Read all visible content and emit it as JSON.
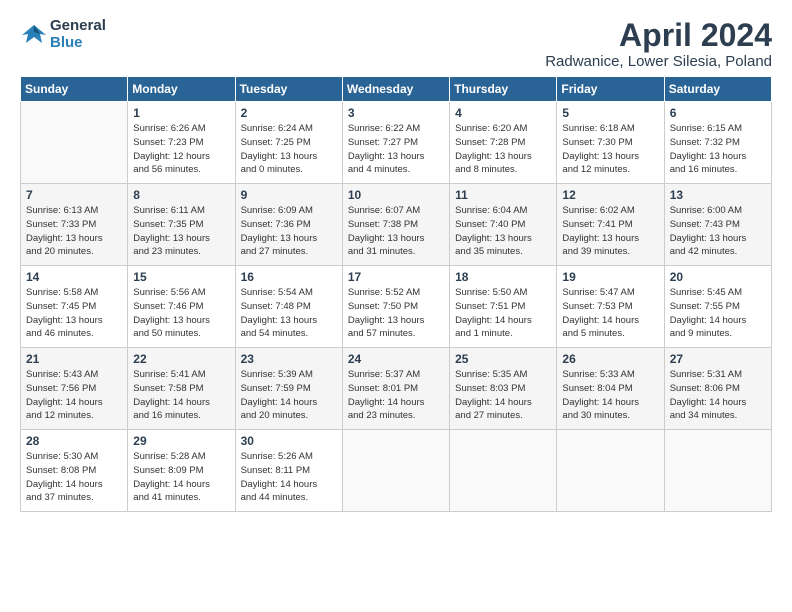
{
  "logo": {
    "general": "General",
    "blue": "Blue"
  },
  "title": "April 2024",
  "subtitle": "Radwanice, Lower Silesia, Poland",
  "days_of_week": [
    "Sunday",
    "Monday",
    "Tuesday",
    "Wednesday",
    "Thursday",
    "Friday",
    "Saturday"
  ],
  "weeks": [
    [
      {
        "num": "",
        "info": ""
      },
      {
        "num": "1",
        "info": "Sunrise: 6:26 AM\nSunset: 7:23 PM\nDaylight: 12 hours\nand 56 minutes."
      },
      {
        "num": "2",
        "info": "Sunrise: 6:24 AM\nSunset: 7:25 PM\nDaylight: 13 hours\nand 0 minutes."
      },
      {
        "num": "3",
        "info": "Sunrise: 6:22 AM\nSunset: 7:27 PM\nDaylight: 13 hours\nand 4 minutes."
      },
      {
        "num": "4",
        "info": "Sunrise: 6:20 AM\nSunset: 7:28 PM\nDaylight: 13 hours\nand 8 minutes."
      },
      {
        "num": "5",
        "info": "Sunrise: 6:18 AM\nSunset: 7:30 PM\nDaylight: 13 hours\nand 12 minutes."
      },
      {
        "num": "6",
        "info": "Sunrise: 6:15 AM\nSunset: 7:32 PM\nDaylight: 13 hours\nand 16 minutes."
      }
    ],
    [
      {
        "num": "7",
        "info": "Sunrise: 6:13 AM\nSunset: 7:33 PM\nDaylight: 13 hours\nand 20 minutes."
      },
      {
        "num": "8",
        "info": "Sunrise: 6:11 AM\nSunset: 7:35 PM\nDaylight: 13 hours\nand 23 minutes."
      },
      {
        "num": "9",
        "info": "Sunrise: 6:09 AM\nSunset: 7:36 PM\nDaylight: 13 hours\nand 27 minutes."
      },
      {
        "num": "10",
        "info": "Sunrise: 6:07 AM\nSunset: 7:38 PM\nDaylight: 13 hours\nand 31 minutes."
      },
      {
        "num": "11",
        "info": "Sunrise: 6:04 AM\nSunset: 7:40 PM\nDaylight: 13 hours\nand 35 minutes."
      },
      {
        "num": "12",
        "info": "Sunrise: 6:02 AM\nSunset: 7:41 PM\nDaylight: 13 hours\nand 39 minutes."
      },
      {
        "num": "13",
        "info": "Sunrise: 6:00 AM\nSunset: 7:43 PM\nDaylight: 13 hours\nand 42 minutes."
      }
    ],
    [
      {
        "num": "14",
        "info": "Sunrise: 5:58 AM\nSunset: 7:45 PM\nDaylight: 13 hours\nand 46 minutes."
      },
      {
        "num": "15",
        "info": "Sunrise: 5:56 AM\nSunset: 7:46 PM\nDaylight: 13 hours\nand 50 minutes."
      },
      {
        "num": "16",
        "info": "Sunrise: 5:54 AM\nSunset: 7:48 PM\nDaylight: 13 hours\nand 54 minutes."
      },
      {
        "num": "17",
        "info": "Sunrise: 5:52 AM\nSunset: 7:50 PM\nDaylight: 13 hours\nand 57 minutes."
      },
      {
        "num": "18",
        "info": "Sunrise: 5:50 AM\nSunset: 7:51 PM\nDaylight: 14 hours\nand 1 minute."
      },
      {
        "num": "19",
        "info": "Sunrise: 5:47 AM\nSunset: 7:53 PM\nDaylight: 14 hours\nand 5 minutes."
      },
      {
        "num": "20",
        "info": "Sunrise: 5:45 AM\nSunset: 7:55 PM\nDaylight: 14 hours\nand 9 minutes."
      }
    ],
    [
      {
        "num": "21",
        "info": "Sunrise: 5:43 AM\nSunset: 7:56 PM\nDaylight: 14 hours\nand 12 minutes."
      },
      {
        "num": "22",
        "info": "Sunrise: 5:41 AM\nSunset: 7:58 PM\nDaylight: 14 hours\nand 16 minutes."
      },
      {
        "num": "23",
        "info": "Sunrise: 5:39 AM\nSunset: 7:59 PM\nDaylight: 14 hours\nand 20 minutes."
      },
      {
        "num": "24",
        "info": "Sunrise: 5:37 AM\nSunset: 8:01 PM\nDaylight: 14 hours\nand 23 minutes."
      },
      {
        "num": "25",
        "info": "Sunrise: 5:35 AM\nSunset: 8:03 PM\nDaylight: 14 hours\nand 27 minutes."
      },
      {
        "num": "26",
        "info": "Sunrise: 5:33 AM\nSunset: 8:04 PM\nDaylight: 14 hours\nand 30 minutes."
      },
      {
        "num": "27",
        "info": "Sunrise: 5:31 AM\nSunset: 8:06 PM\nDaylight: 14 hours\nand 34 minutes."
      }
    ],
    [
      {
        "num": "28",
        "info": "Sunrise: 5:30 AM\nSunset: 8:08 PM\nDaylight: 14 hours\nand 37 minutes."
      },
      {
        "num": "29",
        "info": "Sunrise: 5:28 AM\nSunset: 8:09 PM\nDaylight: 14 hours\nand 41 minutes."
      },
      {
        "num": "30",
        "info": "Sunrise: 5:26 AM\nSunset: 8:11 PM\nDaylight: 14 hours\nand 44 minutes."
      },
      {
        "num": "",
        "info": ""
      },
      {
        "num": "",
        "info": ""
      },
      {
        "num": "",
        "info": ""
      },
      {
        "num": "",
        "info": ""
      }
    ]
  ]
}
